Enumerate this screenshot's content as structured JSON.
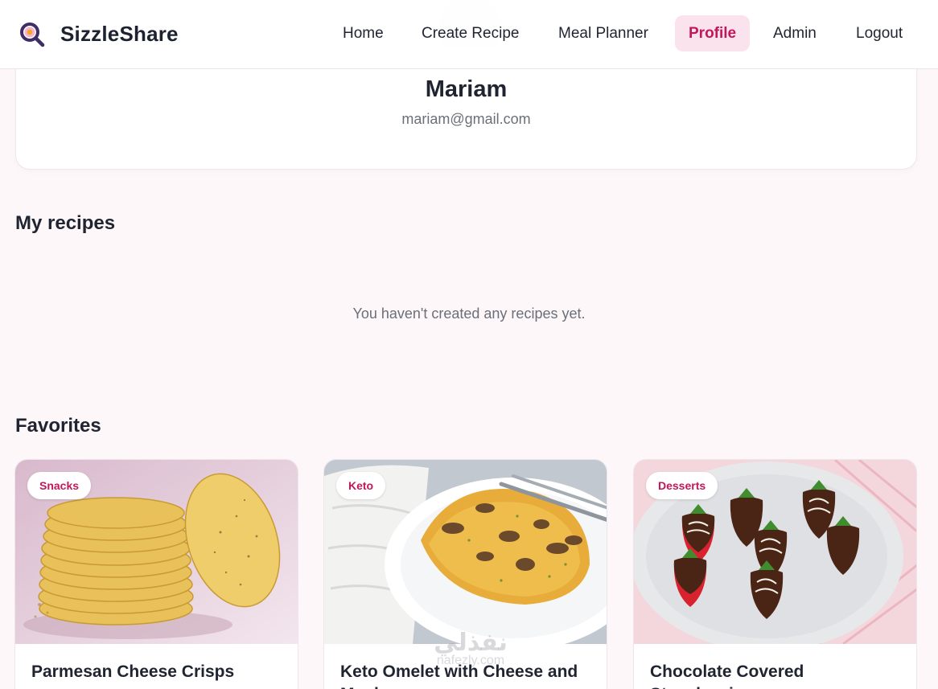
{
  "app": {
    "name": "SizzleShare",
    "logo_icon": "magnifier-pan-icon"
  },
  "nav": {
    "items": [
      {
        "label": "Home",
        "active": false
      },
      {
        "label": "Create Recipe",
        "active": false
      },
      {
        "label": "Meal Planner",
        "active": false
      },
      {
        "label": "Profile",
        "active": true
      },
      {
        "label": "Admin",
        "active": false
      },
      {
        "label": "Logout",
        "active": false
      }
    ]
  },
  "profile": {
    "name": "Mariam",
    "email": "mariam@gmail.com"
  },
  "my_recipes": {
    "title": "My recipes",
    "empty_message": "You haven't created any recipes yet."
  },
  "favorites": {
    "title": "Favorites",
    "cards": [
      {
        "category": "Snacks",
        "title": "Parmesan Cheese Crisps"
      },
      {
        "category": "Keto",
        "title": "Keto Omelet with Cheese and Mushrooms"
      },
      {
        "category": "Desserts",
        "title": "Chocolate Covered Strawberries"
      }
    ]
  },
  "watermark": {
    "arabic": "نفذلي",
    "latin": "nafezly.com"
  },
  "colors": {
    "accent": "#c2185b",
    "accent_bg": "#fbe3ee",
    "page_bg": "#fdf7f9",
    "text": "#1f2430",
    "muted": "#6b6f78"
  }
}
